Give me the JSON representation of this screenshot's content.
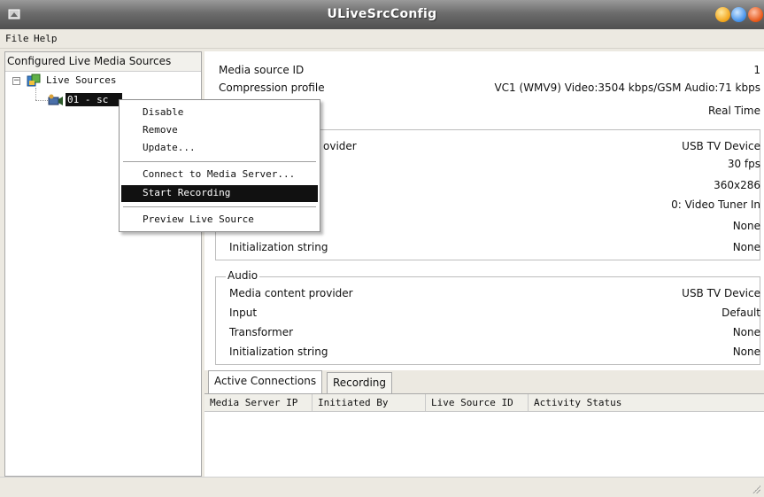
{
  "window": {
    "title": "ULiveSrcConfig"
  },
  "menu": {
    "items": [
      "File",
      "Help"
    ]
  },
  "left_pane": {
    "header": "Configured Live Media Sources",
    "tree": {
      "root_label": "Live Sources",
      "child_label": "01 - sc"
    }
  },
  "context_menu": {
    "items": [
      {
        "label": "Disable"
      },
      {
        "label": "Remove"
      },
      {
        "label": "Update..."
      },
      {
        "label": "Connect to Media Server..."
      },
      {
        "label": "Start Recording",
        "highlighted": true
      },
      {
        "label": "Preview Live Source"
      }
    ]
  },
  "details": {
    "rows": [
      {
        "label": "Media source ID",
        "value": "1"
      },
      {
        "label": "Compression profile",
        "value": "VC1 (WMV9) Video:3504 kbps/GSM Audio:71 kbps"
      },
      {
        "label": "",
        "value": "Real Time"
      }
    ],
    "video": {
      "rows": [
        {
          "label": "Media content provider",
          "visible_label": "ovider",
          "value": "USB TV Device"
        },
        {
          "label": "",
          "value": "30 fps"
        },
        {
          "label": "",
          "value": "360x286"
        },
        {
          "label": "",
          "value": "0: Video Tuner In"
        },
        {
          "label": "",
          "value": "None"
        },
        {
          "label": "Initialization string",
          "value": "None"
        }
      ]
    },
    "audio": {
      "title": "Audio",
      "rows": [
        {
          "label": "Media content provider",
          "value": "USB TV Device"
        },
        {
          "label": "Input",
          "value": "Default"
        },
        {
          "label": "Transformer",
          "value": "None"
        },
        {
          "label": "Initialization string",
          "value": "None"
        }
      ]
    }
  },
  "tabs": [
    {
      "label": "Active Connections",
      "active": true
    },
    {
      "label": "Recording",
      "active": false
    }
  ],
  "grid": {
    "columns": [
      "Media Server IP",
      "Initiated By",
      "Live Source ID",
      "Activity Status"
    ]
  },
  "colors": {
    "titlebar": "#6c6c6c",
    "menu_highlight": "#111111",
    "window_bg": "#ece9e1"
  },
  "icons": {
    "app": "app-icon",
    "tree_root": "live-sources-icon",
    "tree_child": "camera-source-icon"
  }
}
